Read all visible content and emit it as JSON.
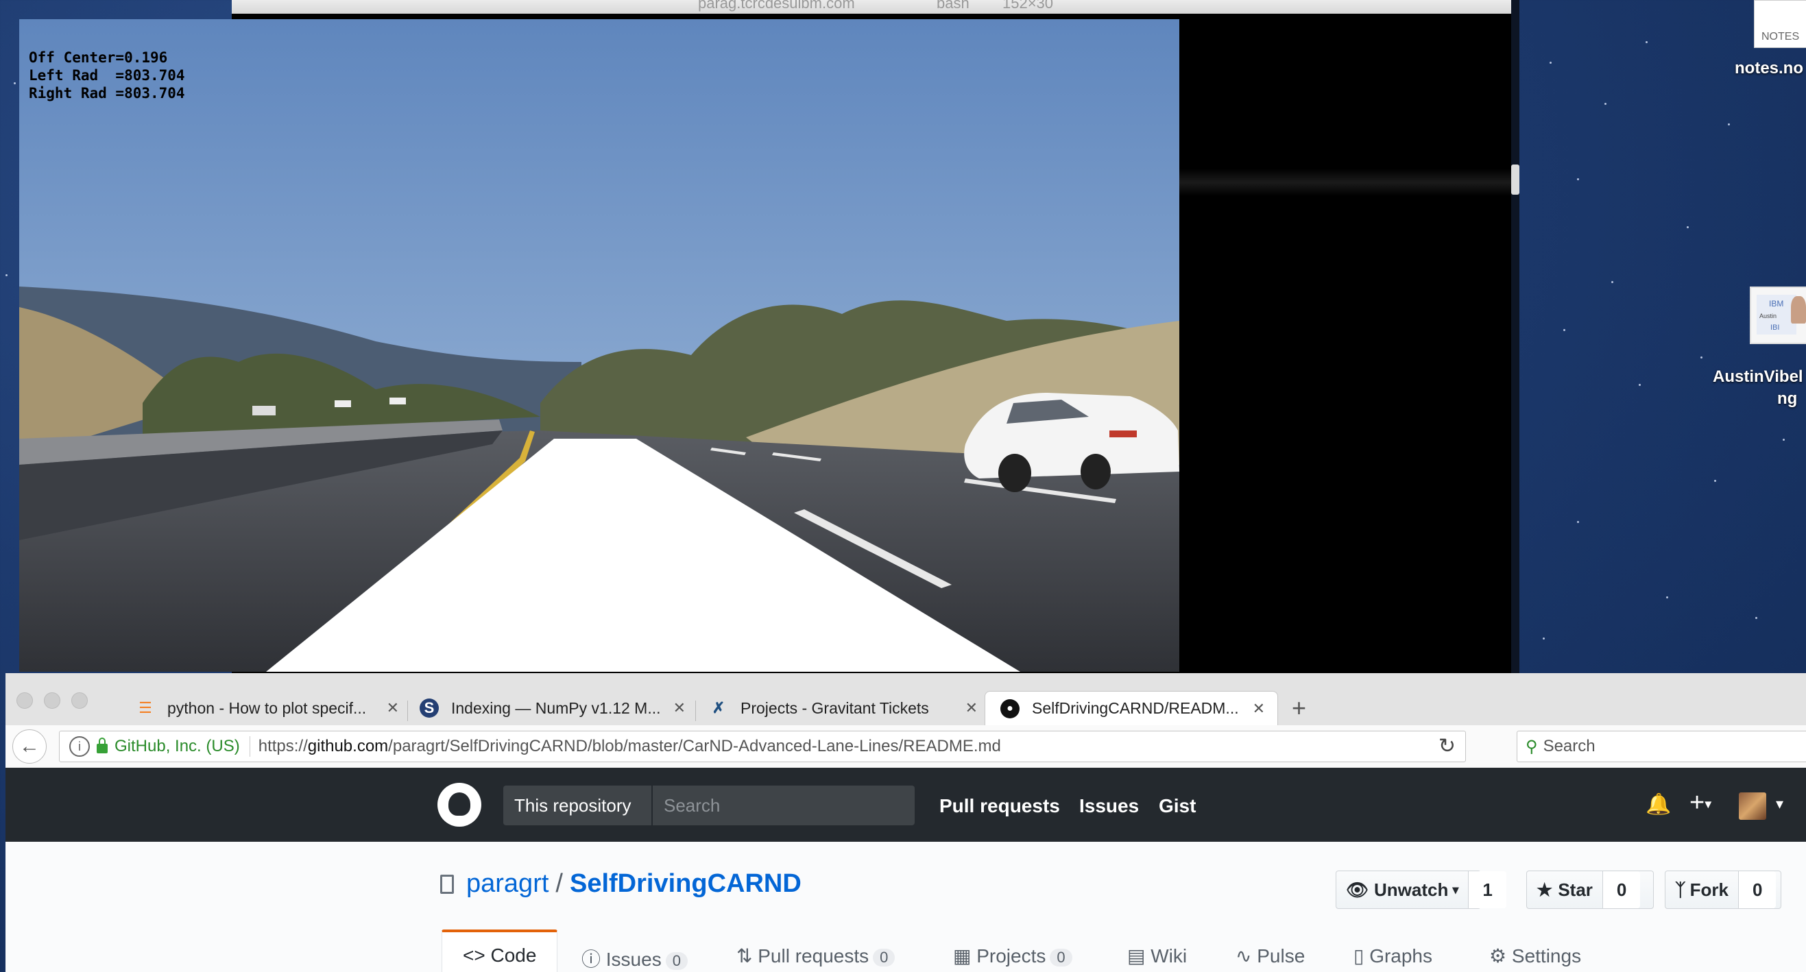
{
  "terminal": {
    "title_host": "parag.tcrcdesulbm.com",
    "title_cmd": "bash",
    "title_size": "152×30"
  },
  "video": {
    "overlay_lines": [
      "Off Center=0.196",
      "Left Rad  =803.704",
      "Right Rad =803.704"
    ]
  },
  "desktop": {
    "notes_thumb_label": "NOTES",
    "notes_file": "notes.no",
    "austin_label_1": "AustinVibel",
    "austin_label_2": "ng",
    "austin_slide_text_1": "IBM",
    "austin_slide_text_2": "Austin",
    "austin_slide_text_3": "IBI"
  },
  "browser": {
    "tabs": [
      {
        "label": "python - How to plot specif...",
        "icon": "stackoverflow-icon"
      },
      {
        "label": "Indexing — NumPy v1.12 M...",
        "icon": "numpy-s-icon"
      },
      {
        "label": "Projects - Gravitant Tickets",
        "icon": "jira-icon"
      },
      {
        "label": "SelfDrivingCARND/READM...",
        "icon": "github-icon"
      }
    ],
    "identity": "GitHub, Inc. (US)",
    "url_prefix": "https://",
    "url_domain": "github.com",
    "url_path": "/paragrt/SelfDrivingCARND/blob/master/CarND-Advanced-Lane-Lines/README.md",
    "search_placeholder": "Search"
  },
  "github": {
    "scope": "This repository",
    "search_placeholder": "Search",
    "nav": [
      "Pull requests",
      "Issues",
      "Gist"
    ],
    "owner": "paragrt",
    "repo": "SelfDrivingCARND",
    "watch_label": "Unwatch",
    "watch_count": "1",
    "star_label": "Star",
    "star_count": "0",
    "fork_label": "Fork",
    "fork_count": "0",
    "tabs": [
      {
        "label": "Code",
        "count": ""
      },
      {
        "label": "Issues",
        "count": "0"
      },
      {
        "label": "Pull requests",
        "count": "0"
      },
      {
        "label": "Projects",
        "count": "0"
      },
      {
        "label": "Wiki",
        "count": ""
      },
      {
        "label": "Pulse",
        "count": ""
      },
      {
        "label": "Graphs",
        "count": ""
      },
      {
        "label": "Settings",
        "count": ""
      }
    ]
  },
  "colors": {
    "github_header": "#24292e",
    "link_blue": "#0366d6",
    "lane_overlay": "#ffffff",
    "sky": "#6f93c6"
  }
}
